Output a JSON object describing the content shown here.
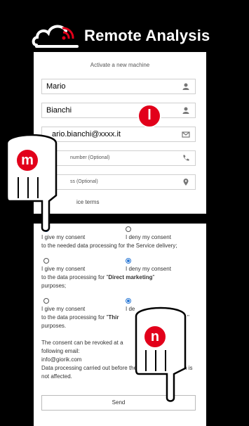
{
  "app": {
    "title": "Remote Analysis",
    "logo_icon": "cloud-wifi-icon"
  },
  "form": {
    "subtitle": "Activate a new machine",
    "first_name": {
      "value": "Mario",
      "icon": "user-icon"
    },
    "last_name": {
      "value": "Bianchi",
      "icon": "user-icon"
    },
    "email": {
      "value": "mario.bianchi@xxxx.it",
      "visible_value": "ario.bianchi@xxxx.it",
      "icon": "envelope-icon"
    },
    "phone": {
      "placeholder": "number (Optional)",
      "icon": "phone-icon"
    },
    "address": {
      "placeholder": "ss (Optional)",
      "icon": "map-pin-icon"
    },
    "terms_text": "ice terms"
  },
  "badges": {
    "top": "l",
    "hand_top": "m",
    "hand_bottom": "n"
  },
  "consents": {
    "give_label": "I give my consent",
    "deny_label": "I deny my consent",
    "group1_text": "to the needed data processing for the Service delivery;",
    "group2_text_prefix": "to the data processing for \"",
    "group2_text_bold": "Direct marketing",
    "group2_text_suffix": "\"",
    "group2_tail": "purposes;",
    "group3_text_prefix": "to the data processing for \"",
    "group3_text_bold": "Thir",
    "group3_tail": "purposes.",
    "group3_deny_partial": "I de",
    "group3_trailing": "\""
  },
  "footer_text": {
    "line1": "The consent can be revoked at a",
    "line2": "following email:",
    "line3": "info@giorik.com",
    "line4_a": "Data processing carried out before the r",
    "line4_b": "n is",
    "line5": "not affected."
  },
  "send_label": "Send",
  "colors": {
    "accent_red": "#e2001a",
    "radio_blue": "#2b79d6"
  }
}
